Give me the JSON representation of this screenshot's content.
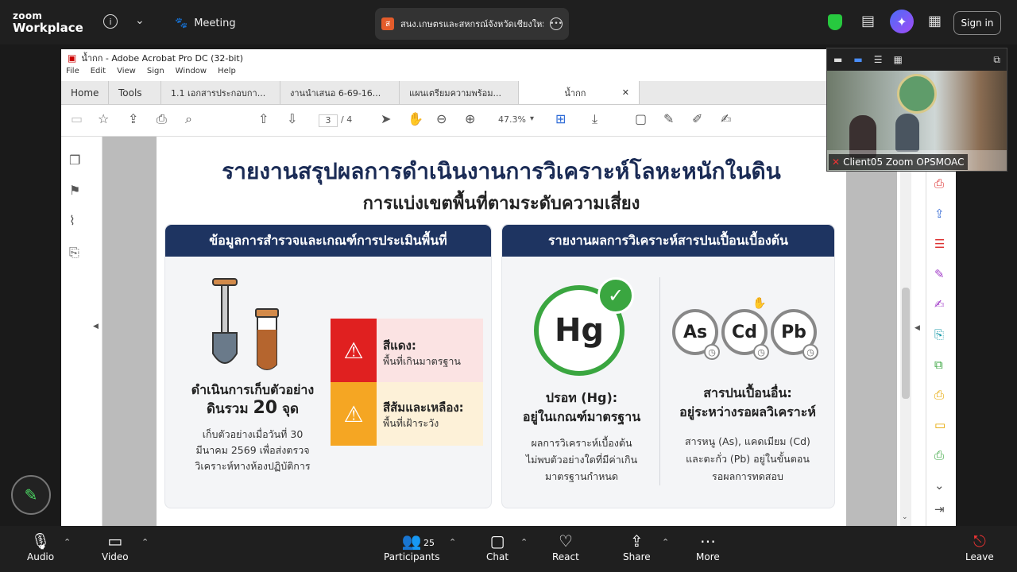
{
  "zoom": {
    "logo_line1": "zoom",
    "logo_line2": "Workplace",
    "meeting_label": "Meeting",
    "share_title": "สนง.เกษตรและสหกรณ์จังหวัดเชียงใหม่",
    "signin_label": "Sign in",
    "accent": "#2d8cff"
  },
  "acrobat": {
    "window_title": "น้ำกก - Adobe Acrobat Pro DC (32-bit)",
    "menus": [
      "File",
      "Edit",
      "View",
      "Sign",
      "Window",
      "Help"
    ],
    "tabs": [
      "Home",
      "Tools",
      "1.1 เอกสารประกอบกา...",
      "งานนำเสนอ 6-69-16...",
      "แผนเตรียมความพร้อม...",
      "น้ำกก"
    ],
    "page_current": "3",
    "page_total": "/ 4",
    "zoom_level": "47.3%"
  },
  "slide": {
    "title": "รายงานสรุปผลการดำเนินงานการวิเคราะห์โลหะหนักในดิน",
    "subtitle": "การแบ่งเขตพื้นที่ตามระดับความเสี่ยง",
    "left_header": "ข้อมูลการสำรวจและเกณฑ์การประเมินพื้นที่",
    "right_header": "รายงานผลการวิเคราะห์สารปนเปื้อนเบื้องต้น",
    "sample_line1": "ดำเนินการเก็บตัวอย่าง",
    "sample_line2": "ดินรวม",
    "sample_count": "20",
    "sample_unit": "จุด",
    "sample_note1": "เก็บตัวอย่างเมื่อวันที่ 30",
    "sample_note2": "มีนาคม 2569 เพื่อส่งตรวจ",
    "sample_note3": "วิเคราะห์ทางห้องปฏิบัติการ",
    "red_title": "สีแดง:",
    "red_desc": "พื้นที่เกินมาตรฐาน",
    "orange_title": "สีส้มและเหลือง:",
    "orange_desc": "พื้นที่เฝ้าระวัง",
    "hg_symbol": "Hg",
    "hg_title1": "ปรอท (Hg):",
    "hg_title2": "อยู่ในเกณฑ์มาตรฐาน",
    "hg_desc1": "ผลการวิเคราะห์เบื้องต้น",
    "hg_desc2": "ไม่พบตัวอย่างใดที่มีค่าเกิน",
    "hg_desc3": "มาตรฐานกำหนด",
    "el1": "As",
    "el2": "Cd",
    "el3": "Pb",
    "other_title1": "สารปนเปื้อนอื่น:",
    "other_title2": "อยู่ระหว่างรอผลวิเคราะห์",
    "other_desc1": "สารหนู (As), แคดเมียม (Cd)",
    "other_desc2": "และตะกั่ว (Pb) อยู่ในขั้นตอน",
    "other_desc3": "รอผลการทดสอบ",
    "red_color": "#e02020",
    "orange_color": "#f5a623",
    "green_color": "#3aa640",
    "navy_color": "#1e3461"
  },
  "camera": {
    "name": "Client05 Zoom OPSMOAC"
  },
  "bottombar": {
    "audio": "Audio",
    "video": "Video",
    "participants": "Participants",
    "participants_count": "25",
    "chat": "Chat",
    "react": "React",
    "share": "Share",
    "more": "More",
    "leave": "Leave"
  }
}
